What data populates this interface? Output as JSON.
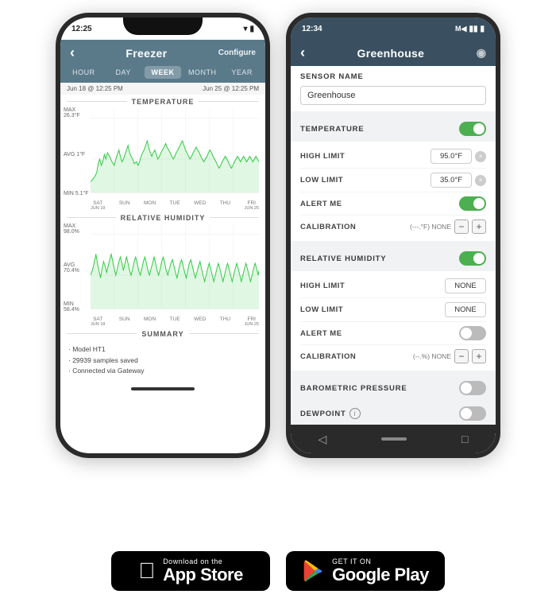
{
  "left_phone": {
    "status_time": "12:25",
    "header_title": "Freezer",
    "header_configure": "Configure",
    "tabs": [
      "HOUR",
      "DAY",
      "WEEK",
      "MONTH",
      "YEAR"
    ],
    "active_tab": "WEEK",
    "date_start": "Jun 18 @ 12:25 PM",
    "date_end": "Jun 25 @ 12:25 PM",
    "temp_chart": {
      "title": "TEMPERATURE",
      "max": "MAX 26.3°F",
      "avg": "AVG 1°F",
      "min": "MIN 5.1°F",
      "x_labels": [
        "SAT",
        "SUN",
        "MON",
        "TUE",
        "WED",
        "THU",
        "FRI"
      ],
      "x_sub": [
        "JUN 18",
        "",
        "",
        "",
        "",
        "",
        "JUN 25"
      ]
    },
    "humidity_chart": {
      "title": "RELATIVE HUMIDITY",
      "max": "MAX 98.0%",
      "avg": "AVG 70.4%",
      "min": "MIN 58.4%",
      "x_labels": [
        "SAT",
        "SUN",
        "MON",
        "TUE",
        "WED",
        "THU",
        "FRI"
      ],
      "x_sub": [
        "JUN 18",
        "",
        "",
        "",
        "",
        "",
        "JUN 25"
      ]
    },
    "summary_title": "SUMMARY",
    "summary_items": [
      "· Model HT1",
      "· 29939 samples saved",
      "· Connected via Gateway"
    ]
  },
  "right_phone": {
    "status_time": "12:34",
    "header_title": "Greenhouse",
    "sensor_name_label": "SENSOR NAME",
    "sensor_name_value": "Greenhouse",
    "temperature_label": "TEMPERATURE",
    "temperature_toggle": "on",
    "high_limit_label": "HIGH LIMIT",
    "high_limit_value": "95.0°F",
    "low_limit_label": "LOW LIMIT",
    "low_limit_value": "35.0°F",
    "alert_me_label": "ALERT ME",
    "alert_me_toggle": "on",
    "calibration_label": "CALIBRATION",
    "calibration_value": "(---.°F) NONE",
    "humidity_label": "RELATIVE HUMIDITY",
    "humidity_toggle": "on",
    "hum_high_label": "HIGH LIMIT",
    "hum_high_value": "NONE",
    "hum_low_label": "LOW LIMIT",
    "hum_low_value": "NONE",
    "hum_alert_label": "ALERT ME",
    "hum_alert_toggle": "off",
    "hum_calib_label": "CALIBRATION",
    "hum_calib_value": "(--.%) NONE",
    "baro_label": "BAROMETRIC PRESSURE",
    "baro_toggle": "off",
    "dewpoint_label": "DEWPOINT",
    "dewpoint_toggle": "off"
  },
  "app_store": {
    "badge_sub": "Download on the",
    "badge_main": "App Store",
    "badge_icon": "apple"
  },
  "google_play": {
    "badge_sub": "GET IT ON",
    "badge_main": "Google Play"
  }
}
